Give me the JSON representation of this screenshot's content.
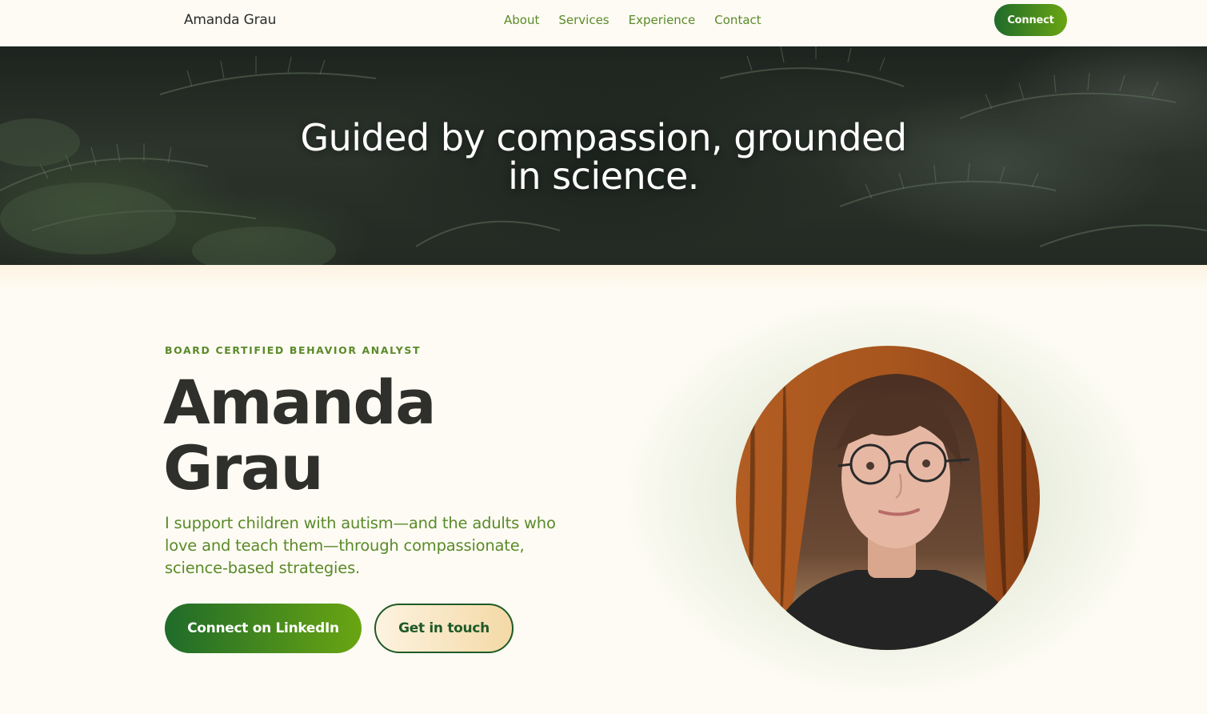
{
  "nav": {
    "brand": "Amanda Grau",
    "links": [
      "About",
      "Services",
      "Experience",
      "Contact"
    ],
    "cta": "Connect"
  },
  "banner": {
    "title_line1": "Guided by compassion, grounded",
    "title_line2": "in science."
  },
  "hero": {
    "eyebrow": "BOARD CERTIFIED BEHAVIOR ANALYST",
    "name_line1": "Amanda",
    "name_line2": "Grau",
    "description": "I support children with autism—and the adults who love and teach them—through compassionate, science-based strategies.",
    "primary_button": "Connect on LinkedIn",
    "secondary_button": "Get in touch"
  },
  "colors": {
    "accent_green": "#5b8a2a",
    "gradient_dark": "#1f6b2a",
    "gradient_light": "#6aa512",
    "page_background": "#fdfbf3",
    "heading_text": "#2f2f2b"
  }
}
